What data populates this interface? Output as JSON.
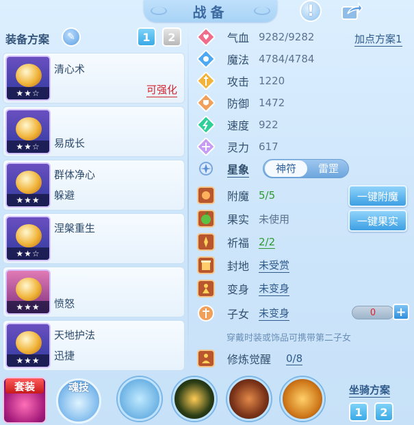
{
  "header": {
    "title": "战备"
  },
  "equip_plan": {
    "label": "装备方案",
    "tabs": [
      "1",
      "2"
    ]
  },
  "skills": [
    {
      "name": "清心术",
      "sub": "",
      "tag": "可强化",
      "stars": "★★☆",
      "color": "#4f7de0"
    },
    {
      "name": "",
      "sub": "易成长",
      "tag": "",
      "stars": "★★☆",
      "color": "#3f7ad8"
    },
    {
      "name": "群体净心",
      "sub": "躲避",
      "tag": "",
      "stars": "★★★",
      "color": "#4e52c2"
    },
    {
      "name": "涅槃重生",
      "sub": "",
      "tag": "",
      "stars": "★★☆",
      "color": "#3b5fc4"
    },
    {
      "name": "",
      "sub": "愤怒",
      "tag": "",
      "stars": "★★★",
      "color": "#c45a9b"
    },
    {
      "name": "天地护法",
      "sub": "迅捷",
      "tag": "",
      "stars": "★★★",
      "color": "#4b56cc"
    }
  ],
  "stats": [
    {
      "label": "气血",
      "value": "9282/9282",
      "icon": "heart-icon",
      "color": "#ef6d8b"
    },
    {
      "label": "魔法",
      "value": "4784/4784",
      "icon": "mana-icon",
      "color": "#4fa8f2"
    },
    {
      "label": "攻击",
      "value": "1220",
      "icon": "attack-icon",
      "color": "#f2b33c"
    },
    {
      "label": "防御",
      "value": "1472",
      "icon": "defense-icon",
      "color": "#f0a05a"
    },
    {
      "label": "速度",
      "value": "922",
      "icon": "speed-icon",
      "color": "#2fcf9a"
    },
    {
      "label": "灵力",
      "value": "617",
      "icon": "spirit-icon",
      "color": "#c89cf2"
    }
  ],
  "add_point_plan": "加点方案1",
  "astro": {
    "label": "星象",
    "options": [
      "神符",
      "雷罡"
    ]
  },
  "enhance": [
    {
      "label": "附魔",
      "value": "5/5",
      "green": true
    },
    {
      "label": "果实",
      "value": "未使用",
      "green": false
    },
    {
      "label": "祈福",
      "value": "2/2",
      "green": true
    },
    {
      "label": "封地",
      "value": "未受赏",
      "green": false
    },
    {
      "label": "变身",
      "value": "未变身",
      "green": false
    },
    {
      "label": "子女",
      "value": "未变身",
      "green": false
    }
  ],
  "buttons": {
    "one_key_enchant": "一键附魔",
    "one_key_fruit": "一键果实"
  },
  "child_count": "0",
  "child_plus": "+",
  "hint": "穿戴时装或饰品可携带第二子女",
  "cultivation": {
    "label": "修炼觉醒",
    "value": "0/8"
  },
  "bottom": {
    "suit_label": "套装",
    "soul_label": "魂技",
    "mount_label": "坐骑方案",
    "mount_tabs": [
      "1",
      "2"
    ]
  },
  "info_mark": "!"
}
